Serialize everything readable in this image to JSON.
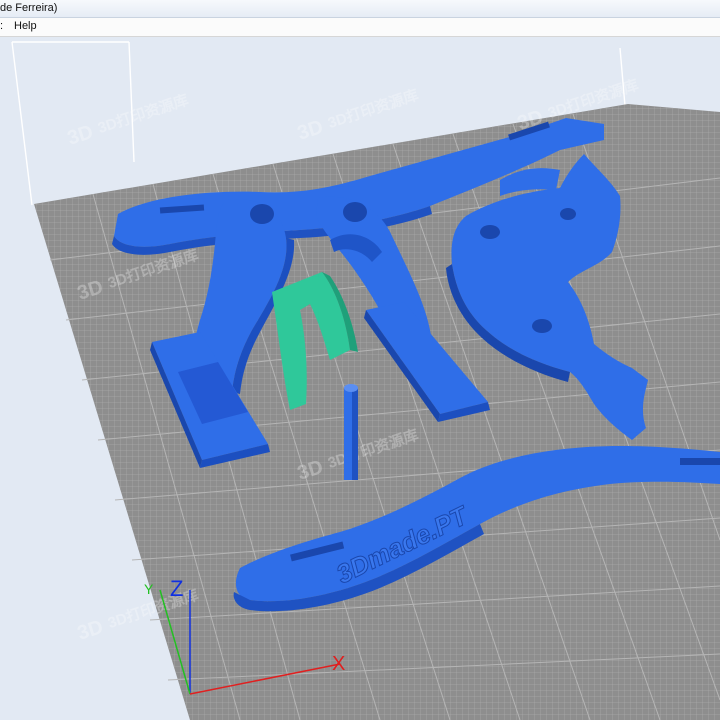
{
  "window": {
    "title": "de Ferreira)"
  },
  "menu": {
    "edge_char": ":",
    "help_label": "Help"
  },
  "viewport": {
    "bed_color": "#8e8e8e",
    "grid_color": "#a8a8a8",
    "model_color": "#2f6ee8",
    "support_color": "#2fc89a",
    "background_color": "#e2e9f3",
    "embossed_text": "3Dmade.PT",
    "axes": {
      "x_label": "X",
      "y_label": "Y",
      "z_label": "Z"
    },
    "watermarks": [
      {
        "logo": "3D",
        "text": "3D打印资源库"
      },
      {
        "logo": "3D",
        "text": "3D打印资源库"
      },
      {
        "logo": "3D",
        "text": "3D打印资源库"
      },
      {
        "logo": "3D",
        "text": "3D打印资源库"
      },
      {
        "logo": "3D",
        "text": "3D打印资源库"
      },
      {
        "logo": "3D",
        "text": "3D打印资源库"
      }
    ]
  }
}
